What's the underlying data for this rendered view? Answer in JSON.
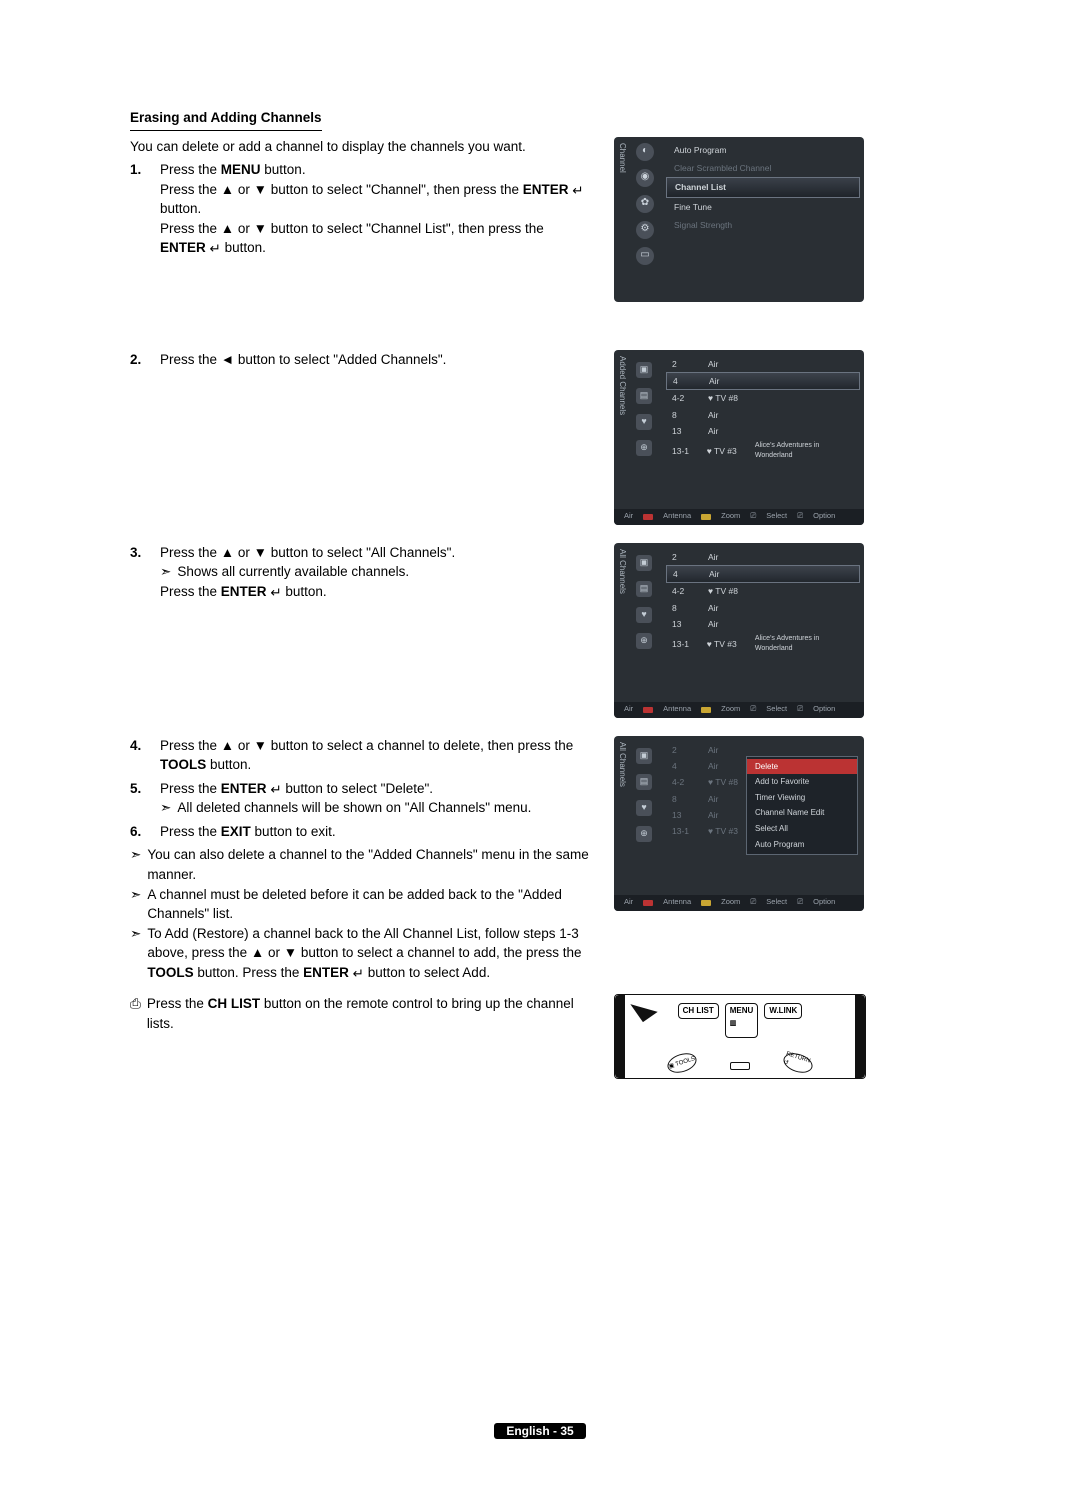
{
  "heading": "Erasing and Adding Channels",
  "intro": "You can delete or add a channel to display the channels you want.",
  "steps": {
    "s1": {
      "num": "1.",
      "l1a": "Press the ",
      "menu": "MENU",
      "l1b": " button.",
      "l2a": "Press the ▲ or ▼ button to select \"Channel\", then press the ",
      "enter": "ENTER",
      "l2b": " button.",
      "l3a": "Press the ▲ or ▼ button to select \"Channel List\", then press the ",
      "l3b": " button."
    },
    "s2": {
      "num": "2.",
      "text": "Press the ◄ button to select \"Added Channels\"."
    },
    "s3": {
      "num": "3.",
      "l1": "Press the ▲ or ▼ button to select \"All Channels\".",
      "note": "Shows all currently available channels.",
      "l2a": "Press the ",
      "l2b": " button."
    },
    "s4": {
      "num": "4.",
      "l1a": "Press the ▲ or ▼ button to select a channel to delete, then press the ",
      "tools": "TOOLS",
      "l1b": " button."
    },
    "s5": {
      "num": "5.",
      "l1a": "Press the ",
      "l1b": " button to select \"Delete\".",
      "note": "All deleted channels will be shown on \"All Channels\" menu."
    },
    "s6": {
      "num": "6.",
      "l1a": "Press the ",
      "exit": "EXIT",
      "l1b": " button to exit."
    },
    "noteA": "You can also delete a channel to the \"Added Channels\" menu in the same manner.",
    "noteB": "A channel must be deleted before it can be added back to the \"Added Channels\" list.",
    "noteC_a": "To Add (Restore) a channel back to the All Channel List, follow steps 1-3 above, press the ▲ or ▼ button to select a channel to add, the press the ",
    "noteC_b": " button. Press the ",
    "noteC_c": " button to select Add.",
    "kb_a": "Press the ",
    "kb_btn": "CH LIST",
    "kb_b": " button on the remote control to bring up the channel lists."
  },
  "screen1": {
    "side": "Channel",
    "items": [
      "Auto Program",
      "Clear Scrambled Channel",
      "Channel List",
      "Fine Tune",
      "Signal Strength"
    ]
  },
  "screen2": {
    "side": "Added Channels",
    "rows": [
      {
        "ch": "2",
        "ty": "Air",
        "name": ""
      },
      {
        "ch": "4",
        "ty": "Air",
        "name": ""
      },
      {
        "ch": "4-2",
        "ty": "♥ TV #8",
        "name": ""
      },
      {
        "ch": "8",
        "ty": "Air",
        "name": ""
      },
      {
        "ch": "13",
        "ty": "Air",
        "name": ""
      },
      {
        "ch": "13-1",
        "ty": "♥ TV #3",
        "name": "Alice's Adventures in Wonderland"
      }
    ]
  },
  "screen3": {
    "side": "All Channels"
  },
  "screen4": {
    "side": "All Channels",
    "popup": [
      "Delete",
      "Add to Favorite",
      "Timer Viewing",
      "Channel Name Edit",
      "Select All",
      "Auto Program"
    ]
  },
  "footerbar": {
    "a": "Air",
    "ant": "Antenna",
    "zoom": "Zoom",
    "sel": "Select",
    "opt": "Option"
  },
  "remote": {
    "chlist": "CH LIST",
    "menu": "MENU",
    "wlink": "W.LINK",
    "tools": "TOOLS",
    "return": "RETURN"
  },
  "footer": "English - 35"
}
